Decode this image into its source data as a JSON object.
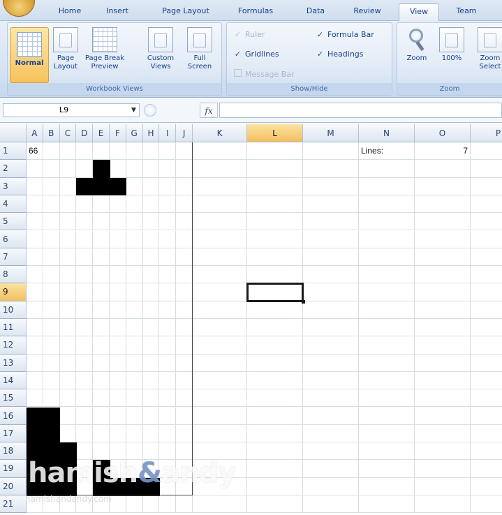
{
  "ribbon": {
    "tabs": [
      {
        "id": "home",
        "label": "Home"
      },
      {
        "id": "insert",
        "label": "Insert"
      },
      {
        "id": "pagelayout",
        "label": "Page Layout"
      },
      {
        "id": "formulas",
        "label": "Formulas"
      },
      {
        "id": "data",
        "label": "Data"
      },
      {
        "id": "review",
        "label": "Review"
      },
      {
        "id": "view",
        "label": "View",
        "active": true
      },
      {
        "id": "team",
        "label": "Team"
      }
    ],
    "workbook_views": {
      "label": "Workbook Views",
      "normal": "Normal",
      "page_layout_1": "Page",
      "page_layout_2": "Layout",
      "page_break_1": "Page Break",
      "page_break_2": "Preview",
      "custom_views_1": "Custom",
      "custom_views_2": "Views",
      "full_screen_1": "Full",
      "full_screen_2": "Screen"
    },
    "show_hide": {
      "label": "Show/Hide",
      "ruler": {
        "label": "Ruler",
        "checked": true,
        "enabled": false
      },
      "gridlines": {
        "label": "Gridlines",
        "checked": true,
        "enabled": true
      },
      "message_bar": {
        "label": "Message Bar",
        "checked": false,
        "enabled": false
      },
      "formula_bar": {
        "label": "Formula Bar",
        "checked": true,
        "enabled": true
      },
      "headings": {
        "label": "Headings",
        "checked": true,
        "enabled": true
      }
    },
    "zoom": {
      "label": "Zoom",
      "zoom": "Zoom",
      "hundred": "100%",
      "zoom_sel_1": "Zoom",
      "zoom_sel_2": "Select"
    },
    "check_mark": "✓"
  },
  "formula_bar": {
    "name_box": "L9",
    "fx": "fx",
    "formula": ""
  },
  "sheet": {
    "columns": [
      "A",
      "B",
      "C",
      "D",
      "E",
      "F",
      "G",
      "H",
      "I",
      "J",
      "K",
      "L",
      "M",
      "N",
      "O",
      "P"
    ],
    "rows": [
      "1",
      "2",
      "3",
      "4",
      "5",
      "6",
      "7",
      "8",
      "9",
      "10",
      "11",
      "12",
      "13",
      "14",
      "15",
      "16",
      "17",
      "18",
      "19",
      "20",
      "21"
    ],
    "active_cell": "L9",
    "cells": {
      "A1": "66",
      "N1": "Lines:",
      "O1": "7"
    },
    "filled_cells": [
      "E2",
      "D3",
      "E3",
      "F3",
      "A16",
      "B16",
      "A17",
      "B17",
      "A18",
      "B18",
      "C18",
      "A19",
      "B19",
      "C19",
      "E19",
      "A20",
      "B20",
      "C20",
      "E20",
      "F20",
      "G20",
      "H20"
    ]
  },
  "watermark": {
    "brand_a": "hamish",
    "amp": "&",
    "brand_b": "andy",
    "url": "hamishandandy.com"
  }
}
